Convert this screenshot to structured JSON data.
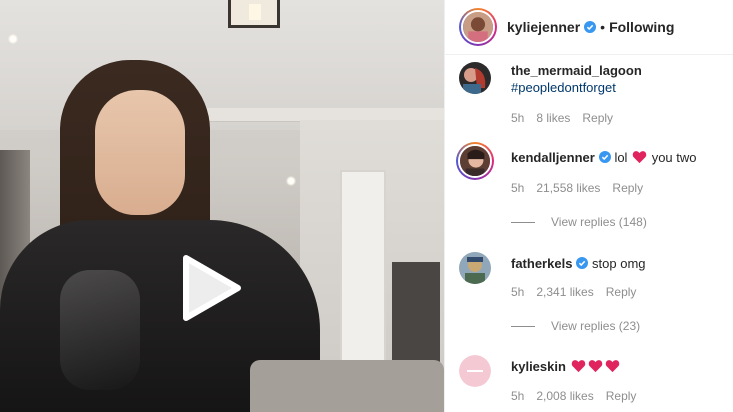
{
  "media": {
    "play_icon": "play-icon"
  },
  "header": {
    "username": "kyliejenner",
    "separator": "•",
    "follow_status": "Following",
    "verified_icon": "verified-badge-icon"
  },
  "comments": [
    {
      "username": "the_mermaid_lagoon",
      "text": "",
      "hashtag": "#peopledontforget",
      "time": "5h",
      "likes": "8 likes",
      "reply": "Reply"
    },
    {
      "username": "kendalljenner",
      "verified": true,
      "text_before": "lol",
      "heart_icon": "red-heart-emoji",
      "text_after": "you two",
      "time": "5h",
      "likes": "21,558 likes",
      "reply": "Reply",
      "view_replies": "View replies (148)"
    },
    {
      "username": "fatherkels",
      "verified": true,
      "text": "stop omg",
      "time": "5h",
      "likes": "2,341 likes",
      "reply": "Reply",
      "view_replies": "View replies (23)"
    },
    {
      "username": "kylieskin",
      "hearts": [
        "red-heart-emoji",
        "red-heart-emoji",
        "red-heart-emoji"
      ],
      "time": "5h",
      "likes": "2,008 likes",
      "reply": "Reply"
    }
  ],
  "colors": {
    "link": "#00376b",
    "secondary_text": "#8e8e8e",
    "verified_blue": "#3897f0",
    "heart_red": "#e0245e"
  }
}
